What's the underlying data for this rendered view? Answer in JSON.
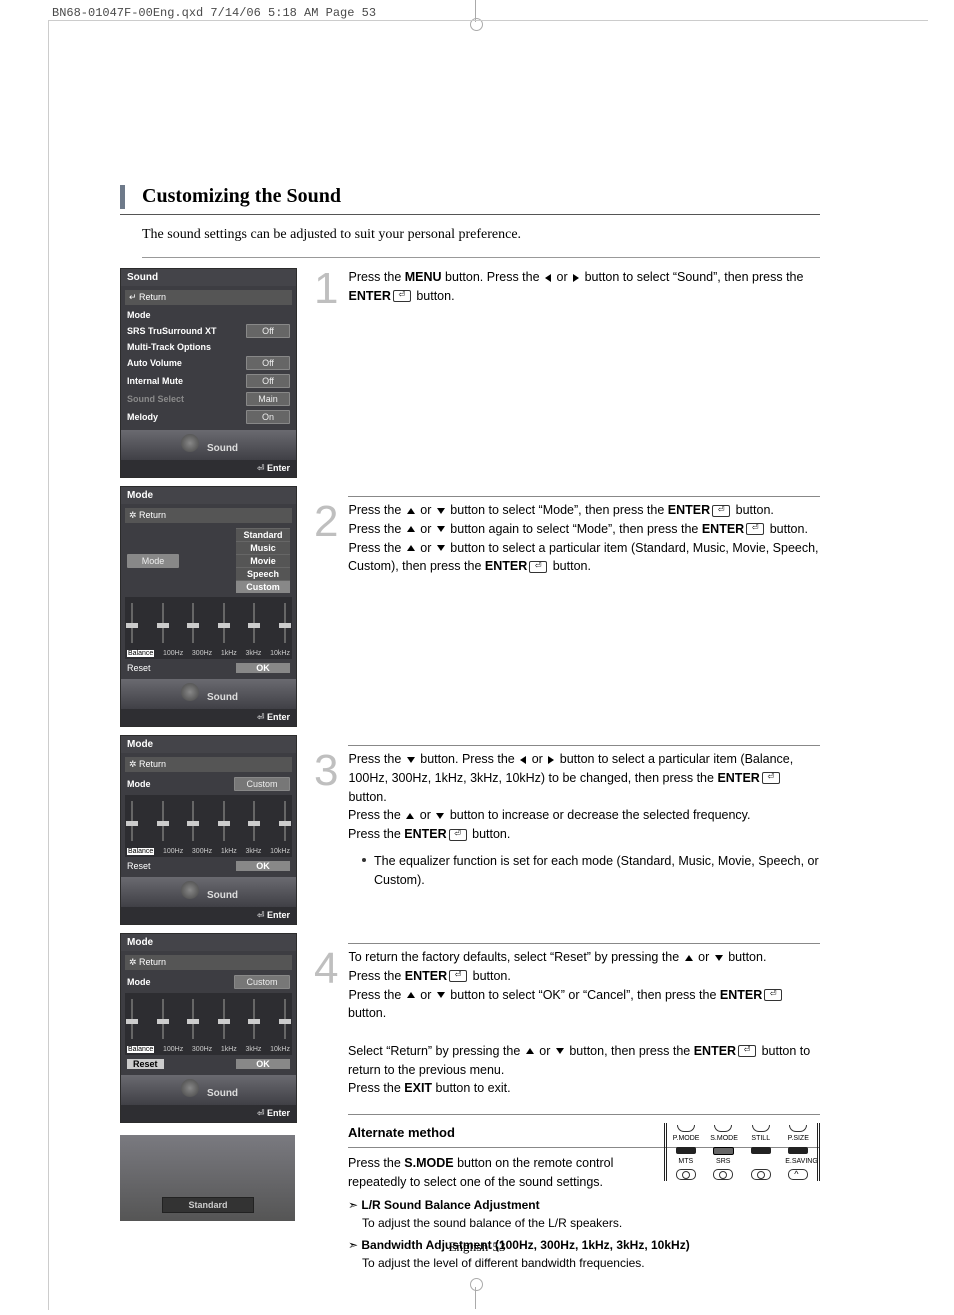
{
  "print_header": "BN68-01047F-00Eng.qxd  7/14/06  5:18 AM  Page 53",
  "page_title": "Customizing the Sound",
  "page_subtitle": "The sound settings can be adjusted to suit your personal preference.",
  "page_number": "English-53",
  "osd1": {
    "title": "Sound",
    "return": "Return",
    "rows": [
      {
        "label": "Mode",
        "value": ""
      },
      {
        "label": "SRS TruSurround XT",
        "value": "Off"
      },
      {
        "label": "Multi-Track Options",
        "value": ""
      },
      {
        "label": "Auto Volume",
        "value": "Off"
      },
      {
        "label": "Internal Mute",
        "value": "Off"
      },
      {
        "label": "Sound Select",
        "value": "Main",
        "dim": true
      },
      {
        "label": "Melody",
        "value": "On"
      }
    ],
    "footer": "Sound",
    "enter": "Enter"
  },
  "osd2": {
    "title": "Mode",
    "return": "Return",
    "mode_label": "Mode",
    "mode_items": [
      "Standard",
      "Music",
      "Movie",
      "Speech",
      "Custom"
    ],
    "eq_labels": [
      "Balance",
      "100Hz",
      "300Hz",
      "1kHz",
      "3kHz",
      "10kHz"
    ],
    "reset": "Reset",
    "ok": "OK",
    "footer": "Sound",
    "enter": "Enter"
  },
  "osd3": {
    "title": "Mode",
    "return": "Return",
    "mode_label": "Mode",
    "mode_value": "Custom",
    "eq_labels": [
      "Balance",
      "100Hz",
      "300Hz",
      "1kHz",
      "3kHz",
      "10kHz"
    ],
    "reset": "Reset",
    "ok": "OK",
    "footer": "Sound",
    "enter": "Enter",
    "balance_hi": true
  },
  "osd4": {
    "title": "Mode",
    "return": "Return",
    "mode_label": "Mode",
    "mode_value": "Custom",
    "eq_labels": [
      "Balance",
      "100Hz",
      "300Hz",
      "1kHz",
      "3kHz",
      "10kHz"
    ],
    "reset": "Reset",
    "ok": "OK",
    "footer": "Sound",
    "enter": "Enter",
    "reset_hi": true
  },
  "osd5_label": "Standard",
  "step1": {
    "num": "1",
    "a": "Press the ",
    "menu": "MENU",
    "b": " button. Press the ",
    "or": " or ",
    "c": " button to select “Sound”, then press the ",
    "enter": "ENTER",
    "d": " button."
  },
  "step2": {
    "num": "2",
    "a": "Press the ",
    "or": " or ",
    "b": " button to select “Mode”, then press the ",
    "enter": "ENTER",
    "c": " button.",
    "d": "Press the ",
    "e": " button again to select “Mode”, then press the ",
    "f": " button. Press the ",
    "g": " button to select a particular item (Standard, Music, Movie, Speech, Custom), then press the ",
    "h": " button."
  },
  "step3": {
    "num": "3",
    "a": "Press the ",
    "b": " button. Press the ",
    "or": " or ",
    "c": " button to select a particular item (Balance, 100Hz, 300Hz, 1kHz, 3kHz, 10kHz) to be changed, then press the ",
    "enter": "ENTER",
    "d": " button.",
    "e": "Press the ",
    "f": " button to increase or decrease the selected frequency.",
    "g": "Press the ",
    "h": " button.",
    "note": "The equalizer function is set for each mode (Standard, Music, Movie, Speech, or Custom)."
  },
  "step4": {
    "num": "4",
    "a": "To return the factory defaults, select “Reset” by pressing the ",
    "or": " or ",
    "b": " button.",
    "c": "Press the ",
    "enter": "ENTER",
    "d": " button.",
    "e": "Press the ",
    "f": " button to select “OK” or “Cancel”, then press the ",
    "g": " button.",
    "h": "Select “Return” by pressing the ",
    "i": " button, then press the ",
    "j": " button to return to the previous menu.",
    "k": "Press the ",
    "exit": "EXIT",
    "l": " button to exit."
  },
  "alt": {
    "heading": "Alternate method",
    "a": "Press the ",
    "smode": "S.MODE",
    "b": " button on the remote control repeatedly to select one of the sound settings.",
    "item1_label": "L/R Sound Balance Adjustment",
    "item1_desc": "To adjust the sound balance of the L/R speakers.",
    "item2_label": "Bandwidth Adjustment (100Hz, 300Hz, 1kHz, 3kHz, 10kHz)",
    "item2_desc": "To adjust the level of different bandwidth frequencies."
  },
  "remote": {
    "r1": [
      "P.MODE",
      "S.MODE",
      "STILL",
      "P.SIZE"
    ],
    "r2": [
      "MTS",
      "SRS",
      "",
      "E.SAVING"
    ]
  }
}
